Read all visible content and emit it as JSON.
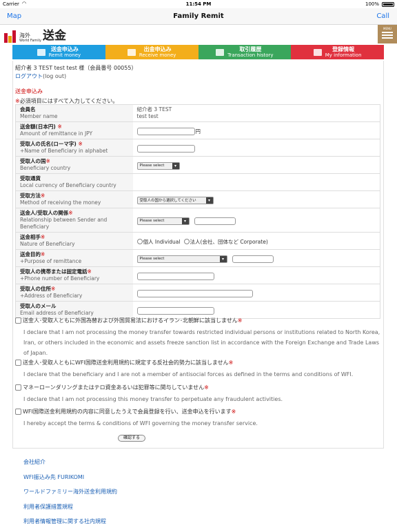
{
  "status_bar": {
    "carrier": "Carrier",
    "time": "11:54 PM",
    "battery": "100%"
  },
  "nav": {
    "left": "Map",
    "title": "Family Remit",
    "right": "Call"
  },
  "logo": {
    "kanji_small": "海外",
    "en_small": "World Family",
    "kanji_big": "送金"
  },
  "menu": {
    "label": "MENU"
  },
  "tabs": [
    {
      "jp": "送金申込み",
      "en": "Remit money",
      "color": "#1e9ee0"
    },
    {
      "jp": "出金申込み",
      "en": "Receive money",
      "color": "#f3ae1b"
    },
    {
      "jp": "取引履歴",
      "en": "Transaction history",
      "color": "#3aa65c"
    },
    {
      "jp": "登録情報",
      "en": "My information",
      "color": "#e0313e"
    }
  ],
  "member_line": "紹介者 3 TEST test test 様（会員番号 00055）",
  "logout": {
    "jp": "ログアウト",
    "en": "(log out)"
  },
  "section_title": "送金申込み",
  "required_note": {
    "mark": "※",
    "text": "必須項目にはすべて入力してください。"
  },
  "req_mark": "※",
  "form": {
    "member_name": {
      "jp": "会員名",
      "en": "Member name",
      "value1": "紹介者 3 TEST",
      "value2": "test test"
    },
    "amount": {
      "jp": "送金額(日本円)",
      "en": "Amount of remittance in JPY",
      "unit": "円"
    },
    "beneficiary_name": {
      "jp": "受取人の氏名(ローマ字)",
      "en": "+Name of Beneficiary in alphabet"
    },
    "beneficiary_country": {
      "jp": "受取人の国",
      "en": "Beneficiary country",
      "select": "Please select"
    },
    "local_currency": {
      "jp": "受取通貨",
      "en": "Local currency of Beneficiary country"
    },
    "method": {
      "jp": "受取方法",
      "en": "Method of receiving the money",
      "select": "受取人の国から選択してください"
    },
    "relationship": {
      "jp": "送金人/受取人の関係",
      "en": "Relationship between Sender and Beneficiary",
      "select": "Please select"
    },
    "nature": {
      "jp": "送金相手",
      "en": "Nature of Beneficiary",
      "opt1": "個人 Individual",
      "opt2": "法人(会社、団体など Corporate)"
    },
    "purpose": {
      "jp": "送金目的",
      "en": "+Purpose of remittance",
      "select": "Please select"
    },
    "phone": {
      "jp": "受取人の携帯または固定電話",
      "en": "+Phone number of Beneficiary"
    },
    "address": {
      "jp": "受取人の住所",
      "en": "+Address of Beneficiary"
    },
    "email": {
      "jp": "受取人のメール",
      "en": "Email address of Beneficiary"
    }
  },
  "declarations": [
    {
      "jp": "送金人･受取人ともに外国為替および外国貿易法におけるイラン･北朝鮮に該当しません",
      "en": "I declare that I am not processing the money transfer towards restricted individual persons or institutions related to North Korea, Iran, or others included in the economic and assets freeze sanction list in accordance with the Foreign Exchange and Trade Laws of Japan."
    },
    {
      "jp": "送金人･受取人ともにWFI国際送金利用規約に規定する反社会的勢力に該当しません",
      "en": "I declare that the beneficiary and I are not a member of antisocial forces as defined in the terms and conditions of WFI."
    },
    {
      "jp": "マネーローンダリングまたはテロ資金あるいは犯罪等に関与していません",
      "en": "I declare that I am not processing this money transfer to perpetuate any fraudulent activities."
    },
    {
      "jp": "WFI国際送金利用規約の内容に同意したうえで会員登録を行い、送金申込を行います",
      "en": "I hereby accept the terms & conditions of WFI governing the money transfer service."
    }
  ],
  "confirm_button": "確認する",
  "footer_links": [
    "会社紹介",
    "WFI振込み先 FURIKOMI",
    "ワールドファミリー海外送金利用規約",
    "利用者保護措置規程",
    "利用者情報管理に関する社内規程"
  ]
}
